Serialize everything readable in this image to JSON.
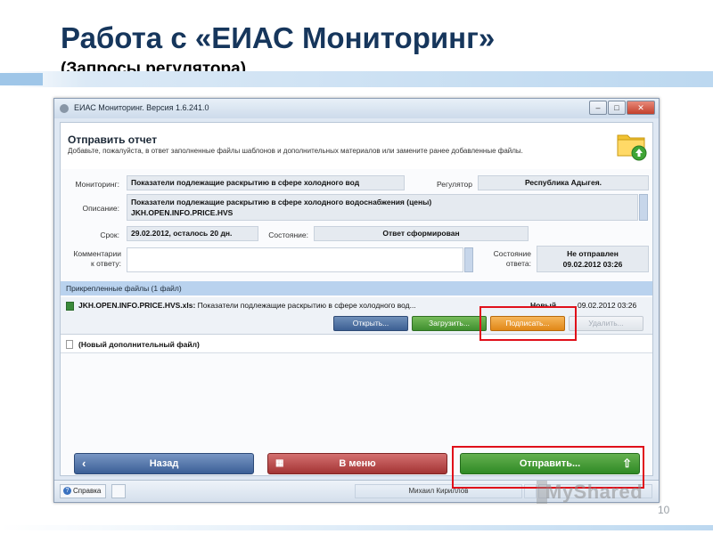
{
  "slide": {
    "title": "Работа с «ЕИАС Мониторинг»",
    "subtitle": "(Запросы регулятора)",
    "page_number": "10",
    "watermark": "MyShared"
  },
  "window": {
    "title": "ЕИАС Мониторинг. Версия 1.6.241.0",
    "controls": {
      "minimize": "–",
      "maximize": "□",
      "close": "✕"
    }
  },
  "header": {
    "title": "Отправить отчет",
    "description": "Добавьте, пожалуйста, в ответ заполненные файлы шаблонов и дополнительных материалов или замените ранее добавленные файлы.",
    "icon": "folder-upload-icon"
  },
  "form": {
    "monitoring_label": "Мониторинг:",
    "monitoring_value": "Показатели подлежащие раскрытию в сфере холодного вод",
    "regulator_label": "Регулятор",
    "regulator_value": "Республика Адыгея.",
    "description_label": "Описание:",
    "description_line1": "Показатели подлежащие раскрытию в сфере холодного водоснабжения (цены)",
    "description_line2": "JKH.OPEN.INFO.PRICE.HVS",
    "deadline_label": "Срок:",
    "deadline_value": "29.02.2012, осталось 20 дн.",
    "state_label": "Состояние:",
    "state_value": "Ответ сформирован",
    "comment_label_line1": "Комментарии",
    "comment_label_line2": "к ответу:",
    "comment_value": "",
    "answer_state_label_line1": "Состояние",
    "answer_state_label_line2": "ответа:",
    "answer_state_line1": "Не отправлен",
    "answer_state_line2": "09.02.2012 03:26"
  },
  "attachments": {
    "header": "Прикрепленные файлы (1 файл)",
    "files": [
      {
        "name": "JKH.OPEN.INFO.PRICE.HVS.xls:",
        "description": " Показатели подлежащие раскрытию в сфере холодного вод...",
        "status": "Новый",
        "date": "09.02.2012 03:26"
      }
    ],
    "buttons": {
      "open": "Открыть...",
      "upload": "Загрузить...",
      "sign": "Подписать...",
      "delete": "Удалить..."
    },
    "new_file_label": "(Новый дополнительный файл)"
  },
  "navigation": {
    "back": "Назад",
    "menu": "В меню",
    "send": "Отправить..."
  },
  "statusbar": {
    "help": "Справка",
    "user": "Михаил Кириллов"
  },
  "colors": {
    "title": "#16365c",
    "highlight": "#e0101a",
    "send_button": "#2f8a25",
    "menu_button": "#a33434",
    "back_button": "#3b5f96",
    "sign_button": "#e08718"
  }
}
